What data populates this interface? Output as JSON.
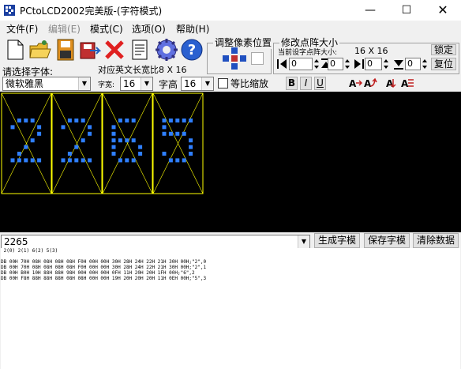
{
  "window": {
    "title": "PCtoLCD2002完美版-(字符模式)"
  },
  "menu": [
    {
      "label": "文件(F)",
      "disabled": false
    },
    {
      "label": "编辑(E)",
      "disabled": true
    },
    {
      "label": "模式(C)",
      "disabled": false
    },
    {
      "label": "选项(O)",
      "disabled": false
    },
    {
      "label": "帮助(H)",
      "disabled": false
    }
  ],
  "pixel_group": {
    "title": "调整像素位置"
  },
  "resize_group": {
    "title": "修改点阵大小",
    "current_label": "当前设字点阵大小:",
    "current_value": "16 X 16",
    "lock_button": "锁定",
    "reset_button": "复位",
    "spin_values": [
      "0",
      "0",
      "0",
      "0"
    ]
  },
  "font": {
    "select_label": "请选择字体:",
    "font_value": "微软雅黑",
    "width_info": "对应英文长宽比8 X 16",
    "width_label": "字宽:",
    "width_value": "16",
    "height_label": "字高",
    "height_value": "16",
    "proportional_label": "等比缩放"
  },
  "style_buttons": {
    "bold": "B",
    "italic": "I",
    "underline": "U"
  },
  "input": {
    "text_value": "2265",
    "generate_button": "生成字模",
    "save_button": "保存字模",
    "clear_button": "清除数据"
  },
  "output": {
    "lines": [
      " 2(0) 2(1) 6(2) 5(3)",
      "",
      "DB 00H 70H 08H 08H 08H 08H F0H 00H 00H 30H 28H 24H 22H 21H 30H 00H;\"2\",0",
      "DB 00H 70H 08H 08H 08H 08H F0H 00H 00H 30H 28H 24H 22H 21H 30H 00H;\"2\",1",
      "DB 00H B0H 10H 88H 88H 98H 00H 00H 00H 0FH 11H 20H 20H 1FH 00H;\"6\",2",
      "DB 00H F8H 88H 88H 88H 08H 08H 00H 00H 19H 20H 20H 20H 11H 0EH 00H;\"5\",3"
    ]
  },
  "glyphs": [
    "2",
    "2",
    "6",
    "5"
  ],
  "colors": {
    "pixel": "#2f7fff",
    "grid_lines": "#ffff00",
    "canvas_bg": "#000000"
  }
}
